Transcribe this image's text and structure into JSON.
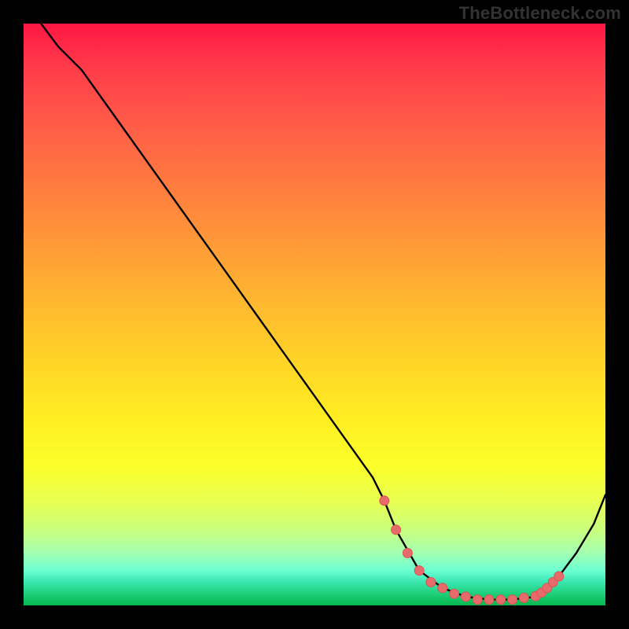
{
  "watermark": "TheBottleneck.com",
  "colors": {
    "page_bg": "#000000",
    "watermark": "#333333",
    "curve": "#000000",
    "markers_fill": "#e86b6b",
    "markers_stroke": "#d95353",
    "gradient_stops": [
      "#ff1744",
      "#ff3d4a",
      "#ff5e47",
      "#ff7c3f",
      "#ff9a37",
      "#ffb82f",
      "#ffd427",
      "#ffee22",
      "#fbff2a",
      "#e8ff50",
      "#c9ff7e",
      "#a3ffb1",
      "#6cffd3",
      "#39e6b0",
      "#1ecf7a",
      "#06b84d"
    ]
  },
  "chart_data": {
    "type": "line",
    "title": "",
    "xlabel": "",
    "ylabel": "",
    "xlim": [
      0,
      100
    ],
    "ylim": [
      0,
      100
    ],
    "grid": false,
    "legend": false,
    "series": [
      {
        "name": "curve",
        "x": [
          3,
          6,
          10,
          15,
          20,
          25,
          30,
          35,
          40,
          45,
          50,
          55,
          60,
          62,
          64,
          68,
          72,
          76,
          80,
          84,
          88,
          90,
          92,
          95,
          98,
          100
        ],
        "y": [
          100,
          96,
          92,
          85,
          78,
          71,
          64,
          57,
          50,
          43,
          36,
          29,
          22,
          18,
          13,
          6,
          3,
          1.5,
          1,
          1,
          1.5,
          3,
          5,
          9,
          14,
          19
        ]
      }
    ],
    "markers": {
      "name": "optimal-range",
      "x": [
        62,
        64,
        66,
        68,
        70,
        72,
        74,
        76,
        78,
        80,
        82,
        84,
        86,
        88,
        89,
        90,
        91,
        92
      ],
      "y": [
        18,
        13,
        9,
        6,
        4,
        3,
        2,
        1.5,
        1,
        1,
        1,
        1,
        1.3,
        1.6,
        2.2,
        3,
        4,
        5
      ]
    }
  }
}
